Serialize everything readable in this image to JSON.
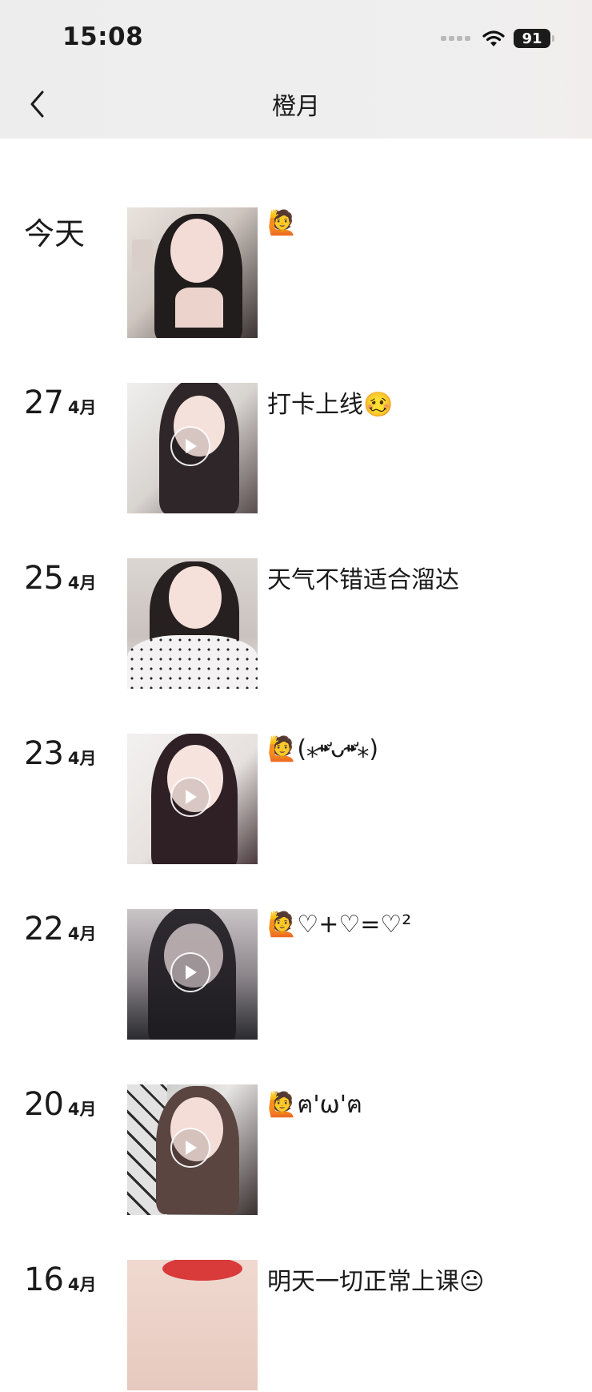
{
  "status_bar": {
    "time": "15:08",
    "battery": "91"
  },
  "nav": {
    "title": "橙月"
  },
  "posts": [
    {
      "day": "今天",
      "month": "",
      "caption": "🙋",
      "is_video": false
    },
    {
      "day": "27",
      "month": "4月",
      "caption": "打卡上线🥴",
      "is_video": true
    },
    {
      "day": "25",
      "month": "4月",
      "caption": "天气不错适合溜达",
      "is_video": false
    },
    {
      "day": "23",
      "month": "4月",
      "caption": "🙋(⁎⁍̴̛ᴗ⁍̴̛⁎)",
      "is_video": true
    },
    {
      "day": "22",
      "month": "4月",
      "caption": "🙋♡+♡=♡²",
      "is_video": true
    },
    {
      "day": "20",
      "month": "4月",
      "caption": "🙋ฅ'ω'ฅ",
      "is_video": true
    },
    {
      "day": "16",
      "month": "4月",
      "caption": "明天一切正常上课😐",
      "is_video": false
    }
  ],
  "icons": {
    "back": "chevron-left-icon",
    "play": "play-icon",
    "wifi": "wifi-icon"
  }
}
